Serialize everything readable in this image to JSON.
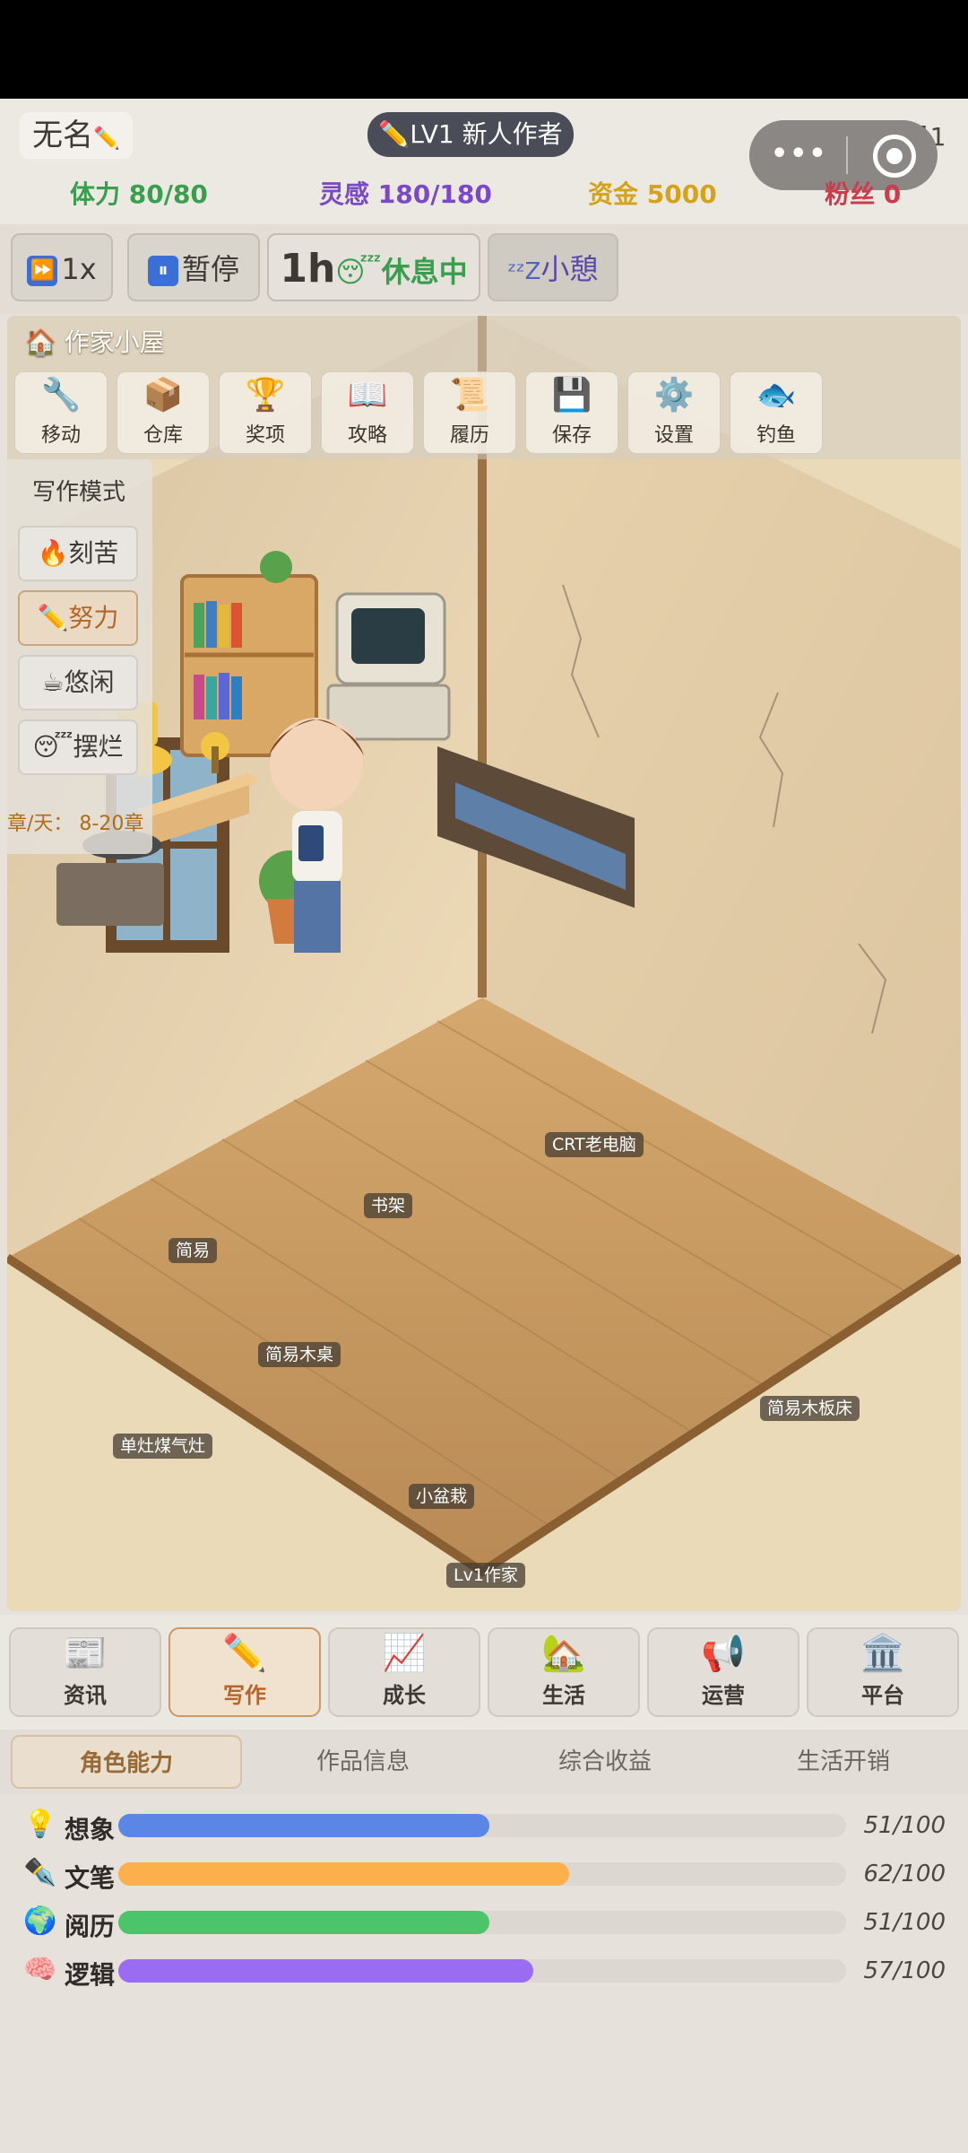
{
  "header": {
    "name": "无名",
    "name_icon": "pencil-icon",
    "level": "✏️LV1 新人作者",
    "date": "第1年1月1日",
    "menu": "•••"
  },
  "stats": {
    "stamina": "体力 80/80",
    "inspiration": "灵感 180/180",
    "funds": "资金 5000",
    "fans": "粉丝 0"
  },
  "colors": {
    "stamina": "#3a9e4f",
    "inspiration": "#7a49c9",
    "funds": "#d6a21a",
    "fans": "#d03a4a"
  },
  "controls": {
    "speed": "1x",
    "pause": "暂停",
    "time": "1h",
    "rest_state": "😴休息中",
    "nap": "小憩"
  },
  "room": {
    "title": "🏠 作家小屋",
    "tools": [
      {
        "icon": "🔧",
        "label": "移动"
      },
      {
        "icon": "📦",
        "label": "仓库"
      },
      {
        "icon": "🏆",
        "label": "奖项"
      },
      {
        "icon": "📖",
        "label": "攻略"
      },
      {
        "icon": "📜",
        "label": "履历"
      },
      {
        "icon": "💾",
        "label": "保存"
      },
      {
        "icon": "⚙️",
        "label": "设置"
      },
      {
        "icon": "🐟",
        "label": "钓鱼"
      }
    ],
    "mode_title": "写作模式",
    "modes": [
      {
        "icon": "🔥",
        "label": "刻苦"
      },
      {
        "icon": "✏️",
        "label": "努力"
      },
      {
        "icon": "☕",
        "label": "悠闲"
      },
      {
        "icon": "😴",
        "label": "摆烂"
      }
    ],
    "mode_range": "章/天： 8-20章",
    "labels": {
      "computer": "CRT老电脑",
      "shelf": "书架",
      "chair": "简易",
      "desk": "简易木桌",
      "bed": "简易木板床",
      "stove": "单灶煤气灶",
      "plant": "小盆栽",
      "player": "Lv1作家"
    }
  },
  "tabs": [
    {
      "icon": "📰",
      "label": "资讯"
    },
    {
      "icon": "✏️",
      "label": "写作"
    },
    {
      "icon": "📈",
      "label": "成长"
    },
    {
      "icon": "🏡",
      "label": "生活"
    },
    {
      "icon": "📢",
      "label": "运营"
    },
    {
      "icon": "🏛️",
      "label": "平台"
    }
  ],
  "subtabs": [
    "角色能力",
    "作品信息",
    "综合收益",
    "生活开销"
  ],
  "abilities": [
    {
      "icon": "💡",
      "label": "想象",
      "value": 51,
      "max": 100,
      "text": "51/100",
      "color": "#5b86e5"
    },
    {
      "icon": "✒️",
      "label": "文笔",
      "value": 62,
      "max": 100,
      "text": "62/100",
      "color": "#fbb04c"
    },
    {
      "icon": "🌍",
      "label": "阅历",
      "value": 51,
      "max": 100,
      "text": "51/100",
      "color": "#4cc46b"
    },
    {
      "icon": "🧠",
      "label": "逻辑",
      "value": 57,
      "max": 100,
      "text": "57/100",
      "color": "#9a6cf2"
    }
  ]
}
